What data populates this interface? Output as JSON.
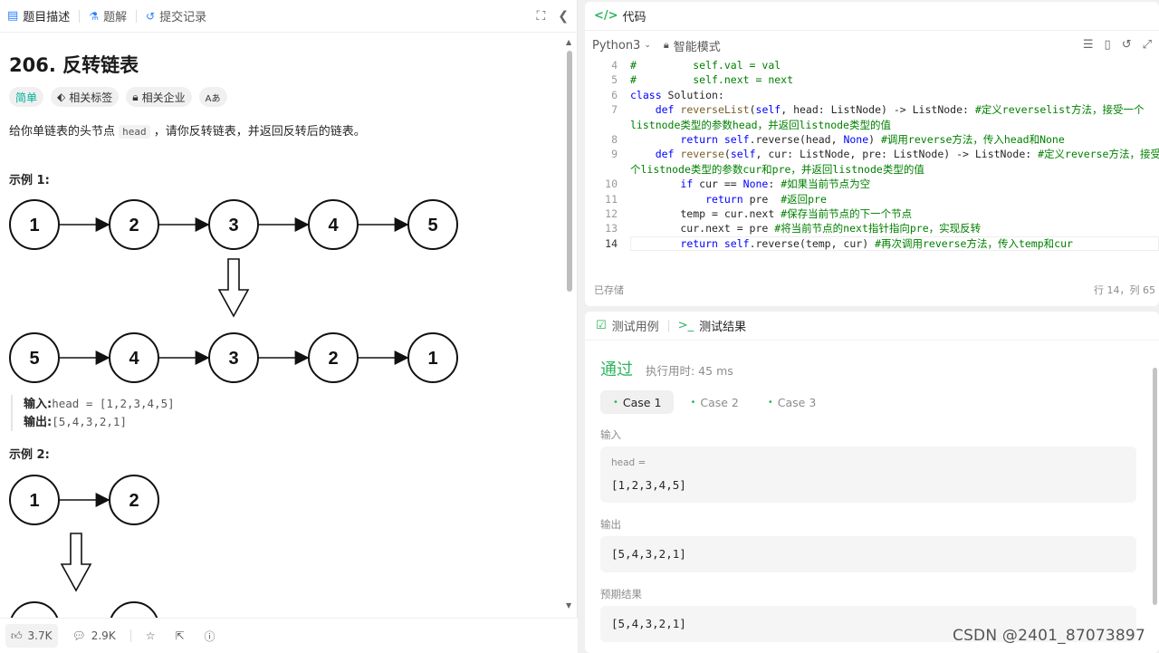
{
  "left_tabs": [
    {
      "label": "题目描述",
      "icon": "description-icon"
    },
    {
      "label": "题解",
      "icon": "flask-icon"
    },
    {
      "label": "提交记录",
      "icon": "history-icon"
    }
  ],
  "problem": {
    "title": "206. 反转链表",
    "tags": {
      "difficulty": "简单",
      "related_tags": "相关标签",
      "companies": "相关企业",
      "translate": "Aあ"
    },
    "description_prefix": "给你单链表的头节点",
    "description_code": "head",
    "description_suffix": "，请你反转链表，并返回反转后的链表。"
  },
  "example1": {
    "title": "示例 1:",
    "top_nodes": [
      "1",
      "2",
      "3",
      "4",
      "5"
    ],
    "bottom_nodes": [
      "5",
      "4",
      "3",
      "2",
      "1"
    ],
    "input_label": "输入:",
    "input_value": "head = [1,2,3,4,5]",
    "output_label": "输出:",
    "output_value": "[5,4,3,2,1]"
  },
  "example2": {
    "title": "示例 2:",
    "top_nodes": [
      "1",
      "2"
    ]
  },
  "footer": {
    "likes": "3.7K",
    "comments": "2.9K"
  },
  "code_panel": {
    "title": "代码",
    "language": "Python3",
    "mode": "智能模式",
    "status_left": "已存储",
    "status_right": "行 14，列 65"
  },
  "code_lines": [
    {
      "n": "4",
      "t": "#         self.val = val"
    },
    {
      "n": "5",
      "t": "#         self.next = next"
    },
    {
      "n": "6",
      "t": "class Solution:"
    },
    {
      "n": "7",
      "t": "    def reverseList(self, head: ListNode) -> ListNode: #定义reverselist方法，接受一个"
    },
    {
      "n": "",
      "t": "listnode类型的参数head，并返回listnode类型的值"
    },
    {
      "n": "8",
      "t": "        return self.reverse(head, None) #调用reverse方法，传入head和None"
    },
    {
      "n": "9",
      "t": "    def reverse(self, cur: ListNode, pre: ListNode) -> ListNode: #定义reverse方法，接受两"
    },
    {
      "n": "",
      "t": "个listnode类型的参数cur和pre，并返回listnode类型的值"
    },
    {
      "n": "10",
      "t": "        if cur == None: #如果当前节点为空"
    },
    {
      "n": "11",
      "t": "            return pre  #返回pre"
    },
    {
      "n": "12",
      "t": "        temp = cur.next #保存当前节点的下一个节点"
    },
    {
      "n": "13",
      "t": "        cur.next = pre #将当前节点的next指针指向pre，实现反转"
    },
    {
      "n": "14",
      "t": "        return self.reverse(temp, cur) #再次调用reverse方法，传入temp和cur"
    }
  ],
  "test_panel": {
    "tab_cases": "测试用例",
    "tab_results": "测试结果",
    "result": "通过",
    "runtime": "执行用时: 45 ms",
    "cases": [
      "Case 1",
      "Case 2",
      "Case 3"
    ],
    "input_label": "输入",
    "input_var": "head =",
    "input_value": "[1,2,3,4,5]",
    "output_label": "输出",
    "output_value": "[5,4,3,2,1]",
    "expected_label": "预期结果",
    "expected_value": "[5,4,3,2,1]"
  },
  "watermark": "CSDN @2401_87073897",
  "colors": {
    "accent_green": "#2db55d",
    "easy": "#00af9b",
    "keyword": "#0000ff",
    "comment": "#008000"
  }
}
